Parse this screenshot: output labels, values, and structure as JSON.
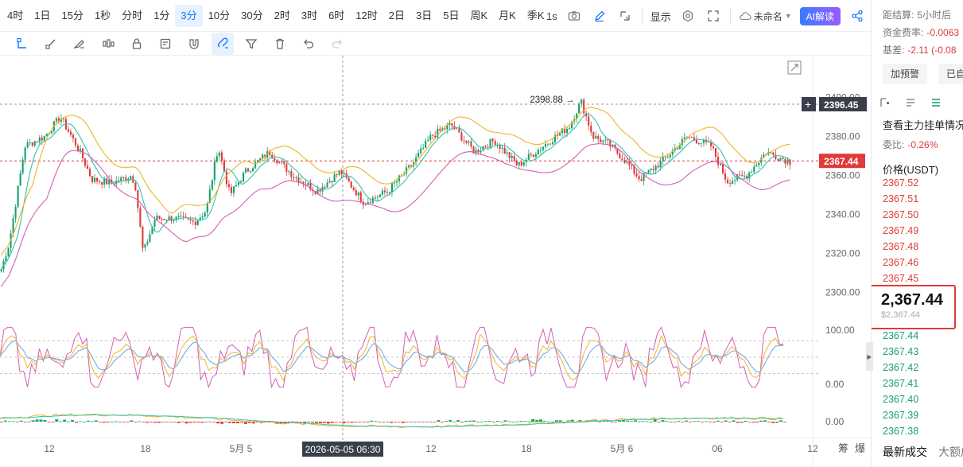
{
  "toolbar": {
    "timeframes": [
      "4时",
      "1日",
      "15分",
      "1秒",
      "分时",
      "1分",
      "3分",
      "10分",
      "30分",
      "2时",
      "3时",
      "6时",
      "12时",
      "2日",
      "3日",
      "5日",
      "周K",
      "月K",
      "季K"
    ],
    "active_timeframe_index": 6,
    "refresh_label": "1s",
    "display_label": "显示",
    "save_name_label": "未命名",
    "ai_label": "AI解读"
  },
  "drawing_tools": [
    "cursor-tool-icon",
    "ruler-icon",
    "brush-icon",
    "candle-icon",
    "lock-icon",
    "note-icon",
    "magnet-icon",
    "filter-icon",
    "trash-icon",
    "undo-icon",
    "redo-icon"
  ],
  "drawing_active_index": 7,
  "right_panel": {
    "settle_label": "距结算:",
    "settle_value": "5小时后",
    "funding_label": "资金费率:",
    "funding_value": "-0.0063",
    "basis_label": "基差:",
    "basis_value": "-2.11 (-0.08",
    "alert_button": "加预警",
    "other_button": "已自",
    "orderbook_title": "查看主力挂单情况",
    "ratio_label": "委比:",
    "ratio_value": "-0.26%",
    "price_header": "价格(USDT)",
    "asks": [
      "2367.52",
      "2367.51",
      "2367.50",
      "2367.49",
      "2367.48",
      "2367.46",
      "2367.45"
    ],
    "last_price": "2,367.44",
    "last_price_usd": "$2,367.44",
    "bids": [
      "2367.44",
      "2367.43",
      "2367.42",
      "2367.41",
      "2367.40",
      "2367.39",
      "2367.38"
    ],
    "bottom_tab_1": "最新成交",
    "bottom_tab_2": "大额成交"
  },
  "colors": {
    "up": "#e03a3a",
    "down": "#17a16b",
    "ma_fast": "#33c2b0",
    "ma_slow": "#f0b429",
    "ma_long": "#d35fb7",
    "accent": "#1677ff"
  },
  "chart_data": {
    "type": "candlestick",
    "symbol_quote": "USDT",
    "y_axis_labels": [
      "2400.00",
      "2380.00",
      "2360.00",
      "2340.00",
      "2320.00",
      "2300.00"
    ],
    "ylim": [
      2295,
      2405
    ],
    "price_tags": {
      "high_marker": "2398.88",
      "crosshair_price": "2396.45",
      "last_price": "2367.44"
    },
    "x_axis_labels": [
      "12",
      "18",
      "5月 5",
      "12",
      "18",
      "5月 6",
      "06",
      "12"
    ],
    "crosshair_time": "2026-05-05 06:30",
    "x_range_labels": [
      "筹",
      "爆"
    ],
    "price_path": [
      [
        0,
        2312
      ],
      [
        0.01,
        2325
      ],
      [
        0.03,
        2375
      ],
      [
        0.055,
        2380
      ],
      [
        0.075,
        2390
      ],
      [
        0.1,
        2372
      ],
      [
        0.115,
        2358
      ],
      [
        0.14,
        2356
      ],
      [
        0.165,
        2360
      ],
      [
        0.17,
        2355
      ],
      [
        0.18,
        2320
      ],
      [
        0.195,
        2338
      ],
      [
        0.22,
        2338
      ],
      [
        0.245,
        2336
      ],
      [
        0.26,
        2342
      ],
      [
        0.275,
        2375
      ],
      [
        0.29,
        2350
      ],
      [
        0.31,
        2362
      ],
      [
        0.34,
        2372
      ],
      [
        0.37,
        2360
      ],
      [
        0.4,
        2352
      ],
      [
        0.43,
        2362
      ],
      [
        0.46,
        2346
      ],
      [
        0.49,
        2352
      ],
      [
        0.52,
        2365
      ],
      [
        0.545,
        2380
      ],
      [
        0.57,
        2386
      ],
      [
        0.6,
        2372
      ],
      [
        0.625,
        2378
      ],
      [
        0.655,
        2365
      ],
      [
        0.69,
        2376
      ],
      [
        0.72,
        2385
      ],
      [
        0.735,
        2398
      ],
      [
        0.75,
        2380
      ],
      [
        0.77,
        2376
      ],
      [
        0.79,
        2368
      ],
      [
        0.81,
        2358
      ],
      [
        0.84,
        2368
      ],
      [
        0.87,
        2380
      ],
      [
        0.9,
        2375
      ],
      [
        0.92,
        2357
      ],
      [
        0.945,
        2360
      ],
      [
        0.97,
        2372
      ],
      [
        1.0,
        2367
      ]
    ],
    "oscillator": {
      "y_axis_labels": [
        "100.00",
        "0.00"
      ],
      "ylim": [
        -10,
        110
      ],
      "dashed_levels": [
        80,
        50,
        20
      ]
    },
    "macd": {
      "y_axis_labels": [
        "0.00"
      ]
    }
  }
}
